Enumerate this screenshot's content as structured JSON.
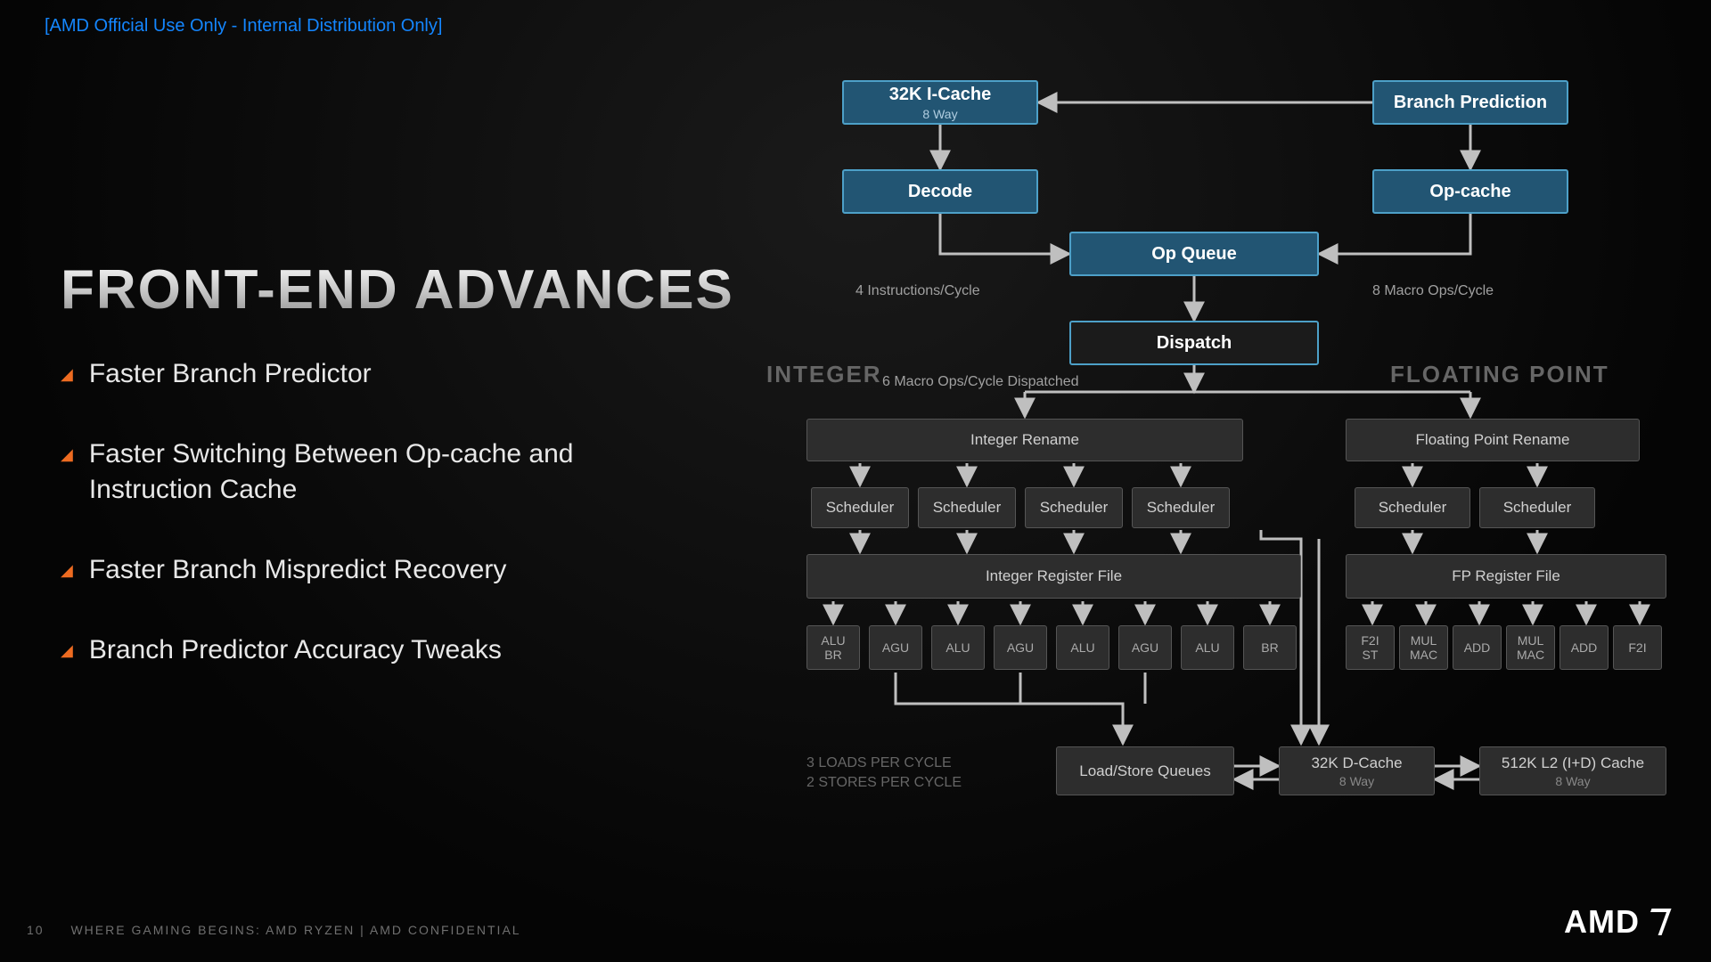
{
  "classification": "[AMD Official Use Only - Internal Distribution Only]",
  "title": "FRONT-END ADVANCES",
  "bullets": [
    "Faster Branch Predictor",
    "Faster Switching Between Op-cache and Instruction Cache",
    "Faster Branch Mispredict Recovery",
    "Branch Predictor Accuracy Tweaks"
  ],
  "footer": {
    "page": "10",
    "text": "WHERE GAMING BEGINS:  AMD RYZEN   |   AMD CONFIDENTIAL"
  },
  "logo": "AMD",
  "diagram": {
    "icache": {
      "t": "32K I-Cache",
      "s": "8 Way"
    },
    "branchpred": "Branch Prediction",
    "decode": "Decode",
    "opcache": "Op-cache",
    "opqueue": "Op Queue",
    "dispatch": "Dispatch",
    "labels": {
      "l4ipc": "4 Instructions/Cycle",
      "l8mop": "8 Macro Ops/Cycle",
      "l6mop": "6 Macro Ops/Cycle Dispatched",
      "loads": "3 LOADS PER CYCLE",
      "stores": "2 STORES PER CYCLE"
    },
    "sections": {
      "int": "INTEGER",
      "fp": "FLOATING POINT"
    },
    "intrename": "Integer Rename",
    "fprename": "Floating Point Rename",
    "sched": "Scheduler",
    "intregfile": "Integer Register File",
    "fpregfile": "FP Register File",
    "intunits": [
      "ALU\nBR",
      "AGU",
      "ALU",
      "AGU",
      "ALU",
      "AGU",
      "ALU",
      "BR"
    ],
    "fpunits": [
      "F2I\nST",
      "MUL\nMAC",
      "ADD",
      "MUL\nMAC",
      "ADD",
      "F2I"
    ],
    "lsq": "Load/Store Queues",
    "dcache": {
      "t": "32K D-Cache",
      "s": "8 Way"
    },
    "l2": {
      "t": "512K L2 (I+D) Cache",
      "s": "8 Way"
    }
  }
}
